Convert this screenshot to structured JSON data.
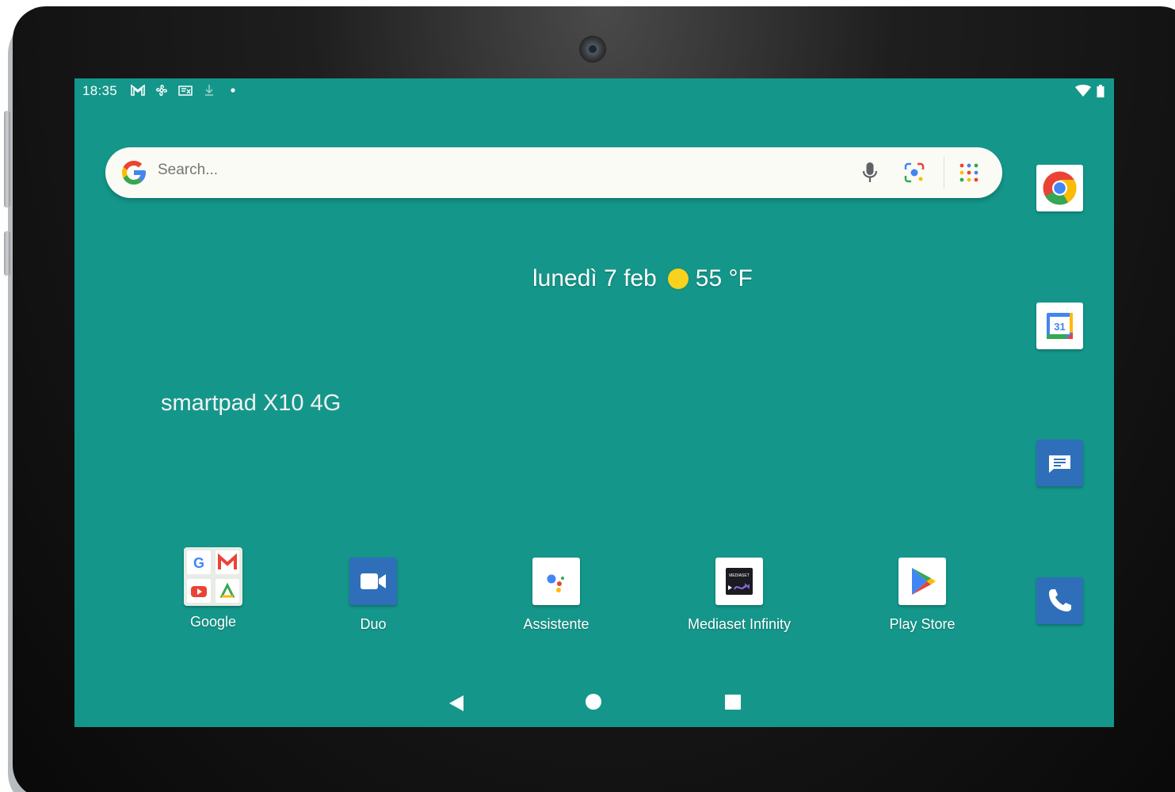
{
  "status_bar": {
    "time": "18:35",
    "left_icons": [
      "gmail-icon",
      "fan-icon",
      "sim-icon",
      "download-icon",
      "dot-icon"
    ],
    "right_icons": [
      "wifi-icon",
      "battery-icon"
    ]
  },
  "search": {
    "placeholder": "Search..."
  },
  "date_widget": {
    "date": "lunedì 7 feb",
    "temperature": "55 °F",
    "weather_icon": "sun-icon"
  },
  "device_label": "smartpad X10 4G",
  "apps": [
    {
      "label": "Google",
      "icon": "google-folder-icon"
    },
    {
      "label": "Duo",
      "icon": "duo-icon"
    },
    {
      "label": "Assistente",
      "icon": "assistant-icon"
    },
    {
      "label": "Mediaset Infinity",
      "icon": "mediaset-icon"
    },
    {
      "label": "Play Store",
      "icon": "play-store-icon"
    }
  ],
  "mediaset_icon_text": "MEDIASET",
  "dock": [
    {
      "icon": "chrome-icon"
    },
    {
      "icon": "calendar-icon",
      "text": "31"
    },
    {
      "icon": "messages-icon"
    },
    {
      "icon": "phone-icon"
    }
  ],
  "nav": [
    "back-icon",
    "home-icon",
    "recents-icon"
  ],
  "colors": {
    "wallpaper": "#14978a",
    "search_bg": "#fbfbf5",
    "google_blue": "#4285f4",
    "google_red": "#ea4335",
    "google_yellow": "#fbbc05",
    "google_green": "#34a853",
    "app_blue": "#2f6fba"
  }
}
